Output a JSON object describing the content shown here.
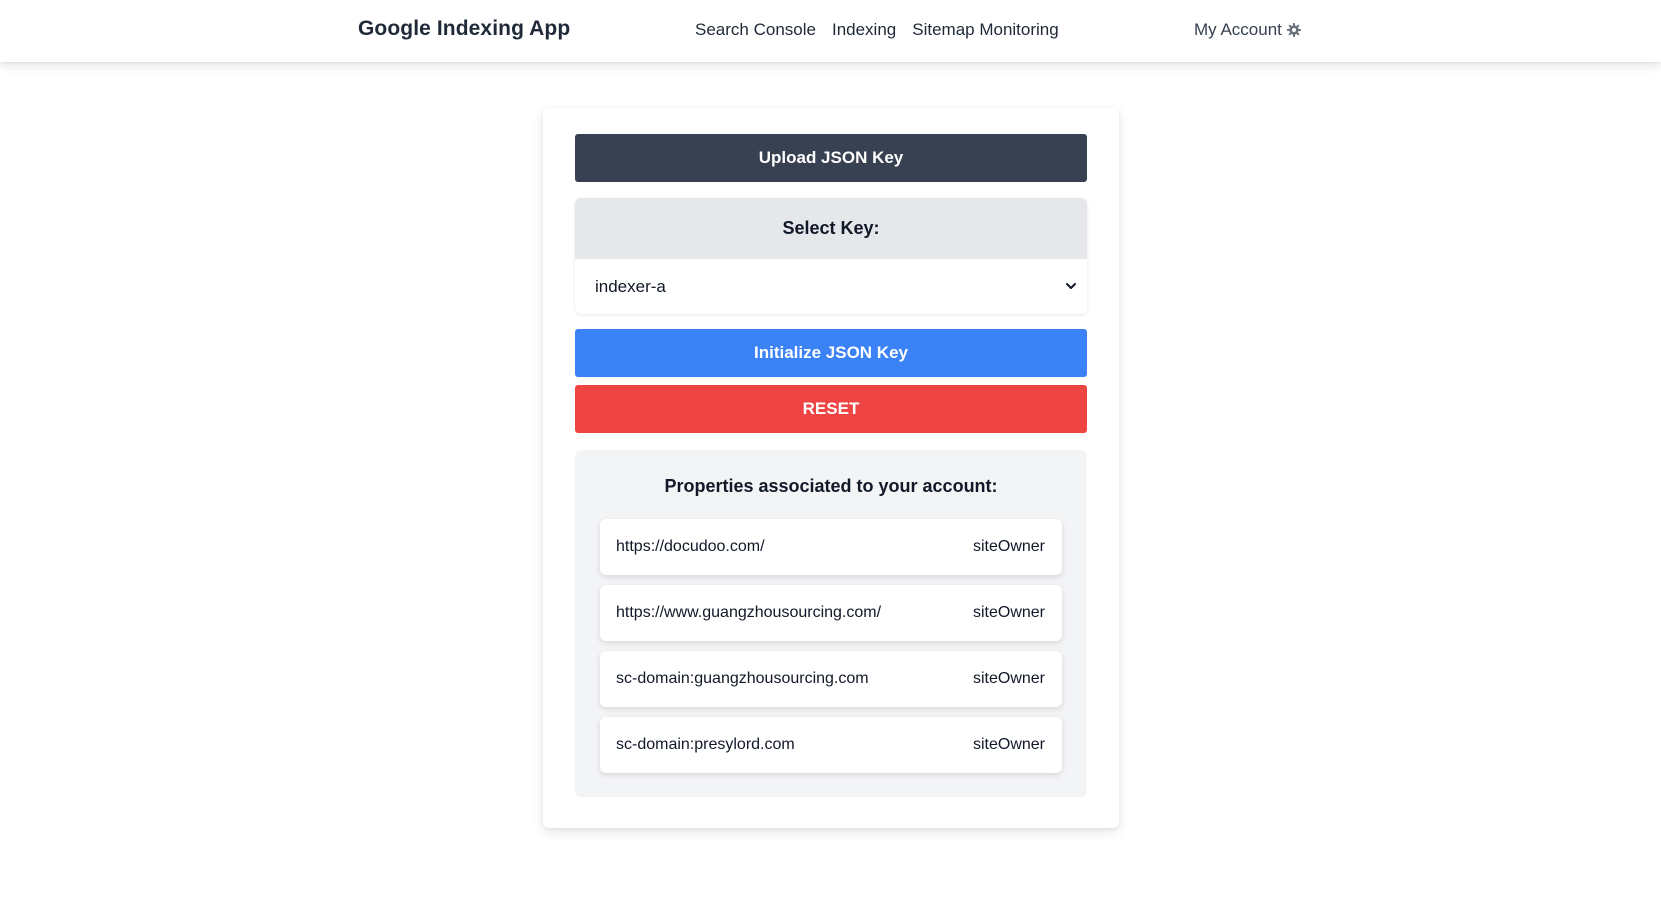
{
  "header": {
    "brand": "Google Indexing App",
    "nav": [
      "Search Console",
      "Indexing",
      "Sitemap Monitoring"
    ],
    "account_label": "My Account",
    "account_icon": "gear-icon"
  },
  "main": {
    "upload_button": "Upload JSON Key",
    "select_key": {
      "label": "Select Key:",
      "selected_value": "indexer-a"
    },
    "initialize_button": "Initialize JSON Key",
    "reset_button": "RESET",
    "properties": {
      "title": "Properties associated to your account:",
      "items": [
        {
          "url": "https://docudoo.com/",
          "role": "siteOwner"
        },
        {
          "url": "https://www.guangzhousourcing.com/",
          "role": "siteOwner"
        },
        {
          "url": "sc-domain:guangzhousourcing.com",
          "role": "siteOwner"
        },
        {
          "url": "sc-domain:presylord.com",
          "role": "siteOwner"
        }
      ]
    }
  },
  "colors": {
    "upload_button": "#374151",
    "initialize_button": "#3b82f6",
    "reset_button": "#ef4444",
    "select_header_bg": "#e5e7eb",
    "properties_bg": "#f3f4f6"
  }
}
